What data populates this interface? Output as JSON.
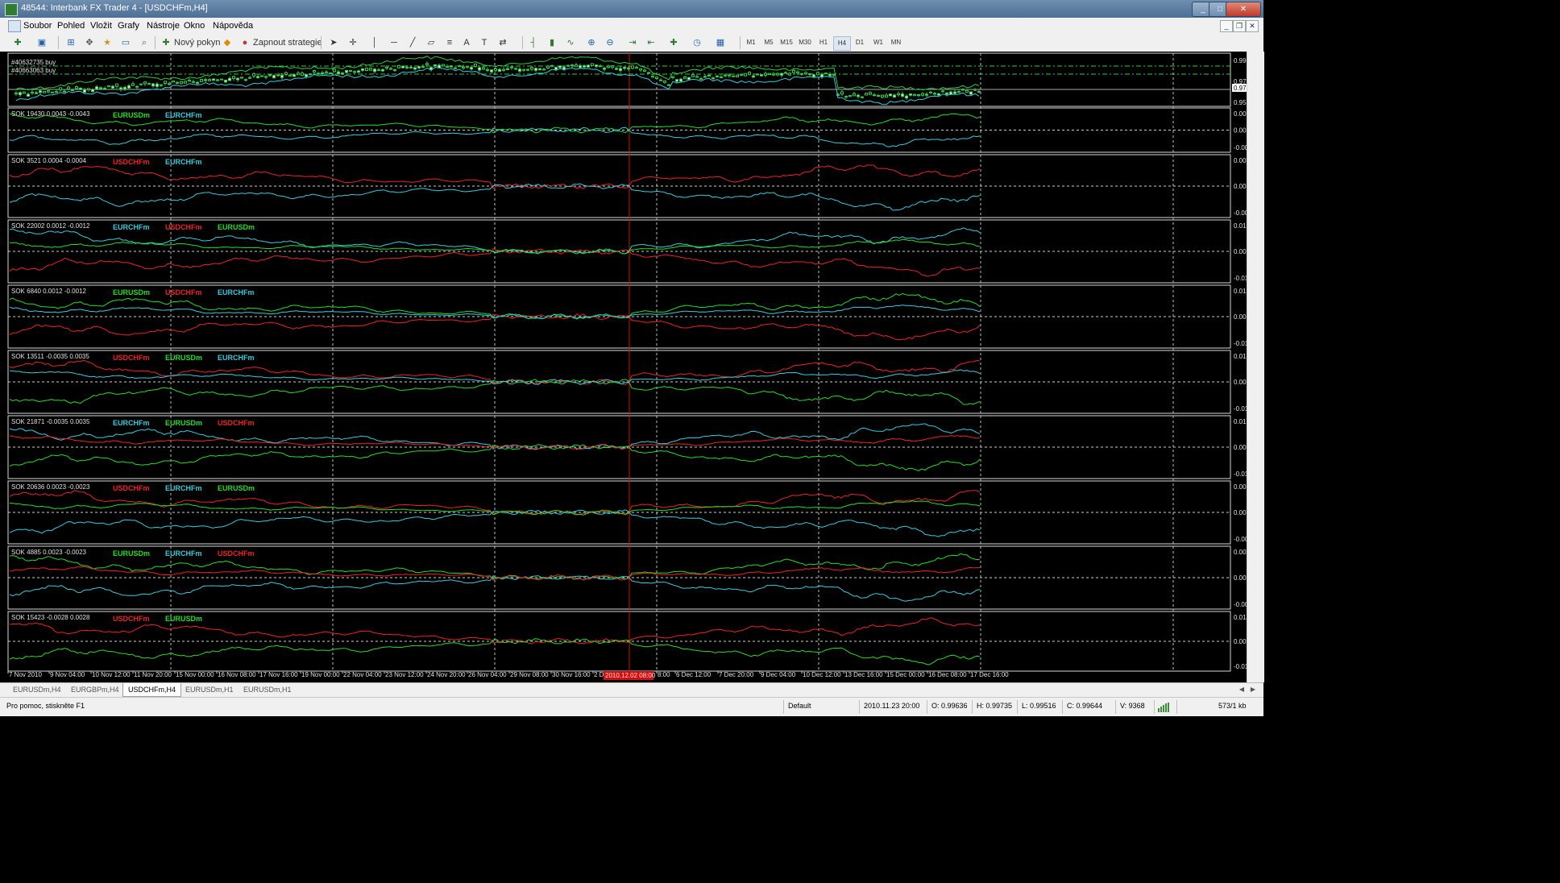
{
  "window": {
    "title": "48544: Interbank FX Trader 4 - [USDCHFm,H4]",
    "minimize": "_",
    "maximize": "□",
    "close": "✕"
  },
  "menu": {
    "items": [
      "Soubor",
      "Pohled",
      "Vložit",
      "Grafy",
      "Nástroje",
      "Okno",
      "Nápověda"
    ]
  },
  "toolbar": {
    "new_order": "Nový pokyn",
    "expert": "Zapnout strategie",
    "timeframes": [
      "M1",
      "M5",
      "M15",
      "M30",
      "H1",
      "H4",
      "D1",
      "W1",
      "MN"
    ],
    "active_timeframe": "H4"
  },
  "main_chart": {
    "orders": [
      "#40632735 buy",
      "#40663063 buy"
    ],
    "price_labels": [
      "0.99795",
      "0.97650",
      "0.97060",
      "0.95570"
    ]
  },
  "panels": [
    {
      "label": "SOK 19430 0.0043 -0.0043",
      "series": [
        {
          "name": "EURUSDm",
          "color": "#22dd22"
        },
        {
          "name": "EURCHFm",
          "color": "#33ccdd"
        }
      ],
      "axis": [
        "0.0071",
        "0.00",
        "-0.0071"
      ]
    },
    {
      "label": "SOK 3521 0.0004 -0.0004",
      "series": [
        {
          "name": "USDCHFm",
          "color": "#ee2222"
        },
        {
          "name": "EURCHFm",
          "color": "#33ccdd"
        }
      ],
      "axis": [
        "0.0095",
        "0.00",
        "-0.0095"
      ]
    },
    {
      "label": "SOK 22002 0.0012 -0.0012",
      "series": [
        {
          "name": "EURCHFm",
          "color": "#33ccdd"
        },
        {
          "name": "USDCHFm",
          "color": "#ee2222"
        },
        {
          "name": "EURUSDm",
          "color": "#22dd22"
        }
      ],
      "axis": [
        "0.012",
        "0.00",
        "-0.012"
      ]
    },
    {
      "label": "SOK 6840 0.0012 -0.0012",
      "series": [
        {
          "name": "EURUSDm",
          "color": "#22dd22"
        },
        {
          "name": "USDCHFm",
          "color": "#ee2222"
        },
        {
          "name": "EURCHFm",
          "color": "#33ccdd"
        }
      ],
      "axis": [
        "0.0121",
        "0.00",
        "-0.0121"
      ]
    },
    {
      "label": "SOK 13511 -0.0035 0.0035",
      "series": [
        {
          "name": "USDCHFm",
          "color": "#ee2222"
        },
        {
          "name": "EURUSDm",
          "color": "#22dd22"
        },
        {
          "name": "EURCHFm",
          "color": "#33ccdd"
        }
      ],
      "axis": [
        "0.0107",
        "0.00",
        "-0.0107"
      ]
    },
    {
      "label": "SOK 21871 -0.0035 0.0035",
      "series": [
        {
          "name": "EURCHFm",
          "color": "#33ccdd"
        },
        {
          "name": "EURUSDm",
          "color": "#22dd22"
        },
        {
          "name": "USDCHFm",
          "color": "#ee2222"
        }
      ],
      "axis": [
        "0.0107",
        "0.00",
        "-0.0107"
      ]
    },
    {
      "label": "SOK 20636 0.0023 -0.0023",
      "series": [
        {
          "name": "USDCHFm",
          "color": "#ee2222"
        },
        {
          "name": "EURCHFm",
          "color": "#33ccdd"
        },
        {
          "name": "EURUSDm",
          "color": "#22dd22"
        }
      ],
      "axis": [
        "0.0032",
        "0.00",
        "-0.0032"
      ]
    },
    {
      "label": "SOK 4885 0.0023 -0.0023",
      "series": [
        {
          "name": "EURUSDm",
          "color": "#22dd22"
        },
        {
          "name": "EURCHFm",
          "color": "#33ccdd"
        },
        {
          "name": "USDCHFm",
          "color": "#ee2222"
        }
      ],
      "axis": [
        "0.0032",
        "0.00",
        "-0.0032"
      ]
    },
    {
      "label": "SOK 15423 -0.0028 0.0028",
      "series": [
        {
          "name": "USDCHFm",
          "color": "#ee2222"
        },
        {
          "name": "EURUSDm",
          "color": "#22dd22"
        }
      ],
      "axis": [
        "0.0146",
        "0.00",
        "-0.0146"
      ]
    }
  ],
  "time_axis": [
    "7 Nov 2010",
    "9 Nov 04:00",
    "10 Nov 12:00",
    "11 Nov 20:00",
    "15 Nov 00:00",
    "16 Nov 08:00",
    "17 Nov 16:00",
    "19 Nov 00:00",
    "22 Nov 04:00",
    "23 Nov 12:00",
    "24 Nov 20:00",
    "26 Nov 04:00",
    "29 Nov 08:00",
    "30 Nov 16:00",
    "2 D",
    "8:00",
    "6 Dec 12:00",
    "7 Dec 20:00",
    "9 Dec 04:00",
    "10 Dec 12:00",
    "13 Dec 16:00",
    "15 Dec 00:00",
    "16 Dec 08:00",
    "17 Dec 16:00"
  ],
  "crosshair_label": "2010.12.02 08:00",
  "tabs": [
    "EURUSDm,H4",
    "EURGBPm,H4",
    "USDCHFm,H4",
    "EURUSDm,H1",
    "EURUSDm,H1"
  ],
  "active_tab": "USDCHFm,H4",
  "status": {
    "help": "Pro pomoc, stiskněte F1",
    "profile": "Default",
    "datetime": "2010.11.23 20:00",
    "open": "O: 0.99636",
    "high": "H: 0.99735",
    "low": "L: 0.99516",
    "close": "C: 0.99644",
    "volume": "V: 9368",
    "traffic": "573/1 kb"
  }
}
